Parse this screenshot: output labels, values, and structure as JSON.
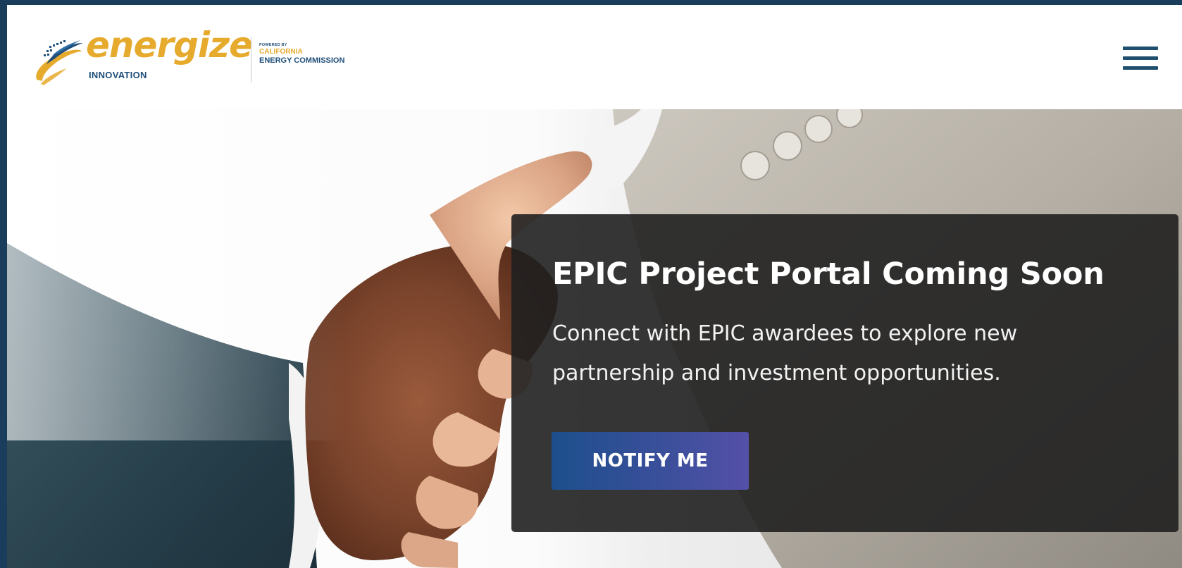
{
  "header": {
    "logo": {
      "word": "energize",
      "sub": "INNOVATION",
      "powered_by": "POWERED BY",
      "org_line1": "CALIFORNIA",
      "org_line2": "ENERGY COMMISSION"
    },
    "menu_icon": "hamburger-menu-icon"
  },
  "hero": {
    "image": "handshake-photo",
    "card": {
      "title": "EPIC Project Portal Coming Soon",
      "description": "Connect with EPIC awardees to explore new partnership and investment opportunities.",
      "button_label": "NOTIFY ME"
    }
  },
  "colors": {
    "frame": "#1b3d5c",
    "logo_gold": "#e6aa2c",
    "logo_blue": "#1f4e79",
    "menu_icon": "#1f4e6e",
    "card_background": "#202020",
    "button_gradient_start": "#1d4f8c",
    "button_gradient_end": "#5450a8"
  }
}
